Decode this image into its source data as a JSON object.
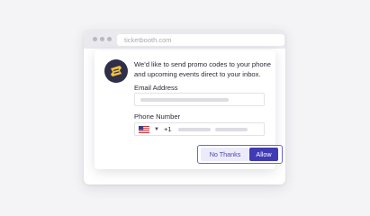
{
  "browser": {
    "url": "ticketbooth.com"
  },
  "prompt": {
    "message": "We'd like to send promo codes to your phone and upcoming events direct to your inbox.",
    "email_label": "Email Address",
    "phone_label": "Phone Number",
    "country_code": "+1",
    "country_flag": "us-flag-icon"
  },
  "actions": {
    "decline_label": "No Thanks",
    "accept_label": "Allow"
  },
  "colors": {
    "accent": "#3f3bb5",
    "accent_light": "#ecebfb",
    "border_accent": "#6b66d9"
  }
}
